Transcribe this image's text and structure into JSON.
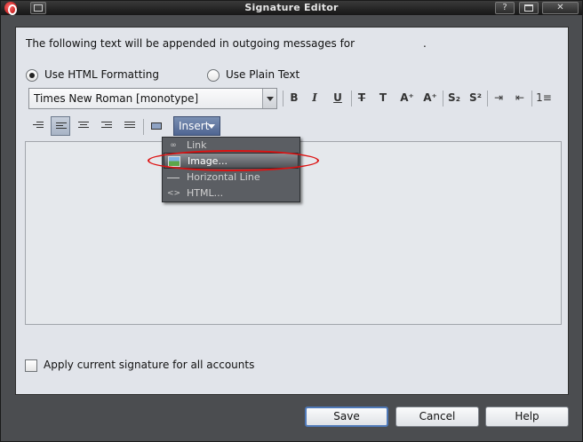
{
  "window": {
    "title": "Signature Editor",
    "help_glyph": "?",
    "close_glyph": "✕"
  },
  "intro": {
    "text": "The following text will be appended in outgoing messages for",
    "suffix": "."
  },
  "format_options": [
    {
      "label": "Use HTML Formatting",
      "checked": true
    },
    {
      "label": "Use Plain Text",
      "checked": false
    }
  ],
  "toolbar": {
    "font_family": "Times New Roman [monotype]",
    "buttons": [
      {
        "name": "bold-button",
        "glyph": "B"
      },
      {
        "name": "italic-button",
        "glyph": "I"
      },
      {
        "name": "underline-button",
        "glyph": "U"
      },
      {
        "name": "strikethrough-button",
        "glyph": "T"
      },
      {
        "name": "clear-format-button",
        "glyph": "T"
      },
      {
        "name": "grow-font-button",
        "glyph": "A⁺"
      },
      {
        "name": "shrink-font-button",
        "glyph": "A⁺"
      },
      {
        "name": "subscript-button",
        "glyph": "S₂"
      },
      {
        "name": "superscript-button",
        "glyph": "S²"
      },
      {
        "name": "indent-button",
        "glyph": "⇥"
      },
      {
        "name": "outdent-button",
        "glyph": "⇤"
      },
      {
        "name": "numbered-list-button",
        "glyph": "1≡"
      }
    ],
    "insert_label": "Insert"
  },
  "insert_menu": {
    "items": [
      {
        "label": "Link",
        "icon": "link-icon",
        "glyph": "∞"
      },
      {
        "label": "Image...",
        "icon": "image-icon",
        "glyph": ""
      },
      {
        "label": "Horizontal Line",
        "icon": "horizontal-line-icon",
        "glyph": ""
      },
      {
        "label": "HTML...",
        "icon": "html-icon",
        "glyph": "<>"
      }
    ],
    "hovered": "Image..."
  },
  "apply_all": {
    "label": "Apply current signature for all accounts",
    "checked": false
  },
  "dialog_buttons": {
    "save": "Save",
    "cancel": "Cancel",
    "help": "Help"
  },
  "colors": {
    "accent": "#4f6591",
    "highlight_ellipse": "#dd1111"
  }
}
